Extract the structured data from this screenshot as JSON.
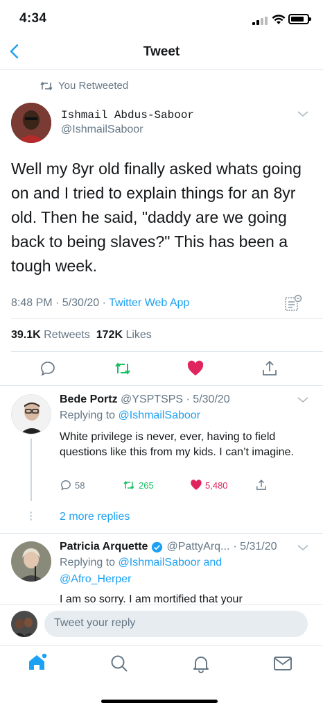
{
  "status_bar": {
    "time": "4:34"
  },
  "nav": {
    "title": "Tweet"
  },
  "retweet_context": {
    "label": "You Retweeted"
  },
  "tweet": {
    "author_name": "Ishmail Abdus-Saboor",
    "author_handle": "@IshmailSaboor",
    "text": "Well my 8yr old finally asked whats going on and I tried to explain things for an 8yr old. Then he said, \"daddy are we going back to being slaves?\" This has been a tough week.",
    "time": "8:48 PM · 5/30/20 · ",
    "source": "Twitter Web App",
    "retweets_count": "39.1K",
    "retweets_label": "Retweets",
    "likes_count": "172K",
    "likes_label": "Likes"
  },
  "replies": [
    {
      "name": "Bede Portz",
      "handle_date": "@YSPTSPS · 5/30/20",
      "replying_prefix": "Replying to ",
      "replying_to": "@IshmailSaboor",
      "text": "White privilege is never, ever, having to field questions like this from my kids. I can’t imagine.",
      "reply_count": "58",
      "retweet_count": "265",
      "like_count": "5,480"
    },
    {
      "name": "Patricia Arquette",
      "handle": "@PattyArq...",
      "date": " · 5/31/20",
      "replying_prefix": "Replying to ",
      "replying_to": "@IshmailSaboor and",
      "replying_to_2": "@Afro_Herper",
      "text": "I am so sorry. I am mortified that your"
    }
  ],
  "more_replies": "2 more replies",
  "composer": {
    "placeholder": "Tweet your reply"
  },
  "colors": {
    "accent": "#1da1f2",
    "retweet_green": "#17bf63",
    "like_red": "#e0245e"
  }
}
